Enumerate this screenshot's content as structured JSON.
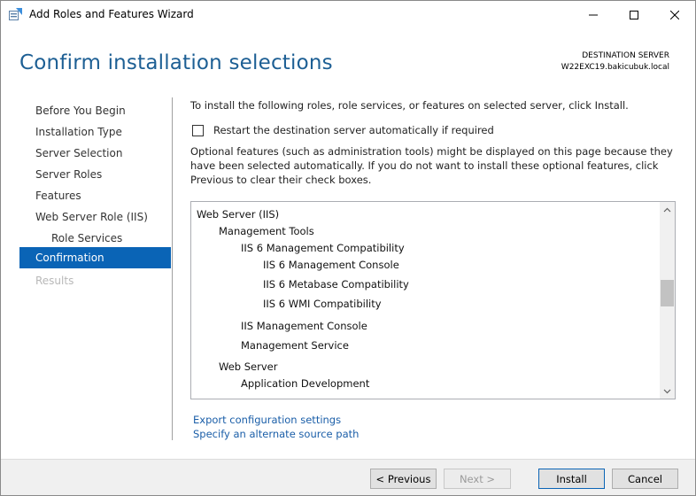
{
  "window": {
    "title": "Add Roles and Features Wizard"
  },
  "header": {
    "page_title": "Confirm installation selections",
    "destination_label": "DESTINATION SERVER",
    "destination_server": "W22EXC19.bakicubuk.local"
  },
  "sidebar": {
    "items": [
      {
        "label": "Before You Begin"
      },
      {
        "label": "Installation Type"
      },
      {
        "label": "Server Selection"
      },
      {
        "label": "Server Roles"
      },
      {
        "label": "Features"
      },
      {
        "label": "Web Server Role (IIS)"
      },
      {
        "label": "Role Services"
      },
      {
        "label": "Confirmation"
      },
      {
        "label": "Results"
      }
    ]
  },
  "content": {
    "intro": "To install the following roles, role services, or features on selected server, click Install.",
    "restart_label": "Restart the destination server automatically if required",
    "note": "Optional features (such as administration tools) might be displayed on this page because they have been selected automatically. If you do not want to install these optional features, click Previous to clear their check boxes.",
    "features": [
      "Web Server (IIS)",
      "Management Tools",
      "IIS 6 Management Compatibility",
      "IIS 6 Management Console",
      "IIS 6 Metabase Compatibility",
      "IIS 6 WMI Compatibility",
      "IIS Management Console",
      "Management Service",
      "Web Server",
      "Application Development"
    ],
    "export_link": "Export configuration settings",
    "source_link": "Specify an alternate source path"
  },
  "footer": {
    "previous_label": "< Previous",
    "next_label": "Next >",
    "install_label": "Install",
    "cancel_label": "Cancel"
  },
  "colors": {
    "accent": "#0a64b6",
    "title": "#1d5f94",
    "link": "#1a5ea8"
  },
  "icons": {
    "app": "server-manager-icon",
    "minimize": "minimize-icon",
    "maximize": "maximize-icon",
    "close": "close-icon"
  }
}
